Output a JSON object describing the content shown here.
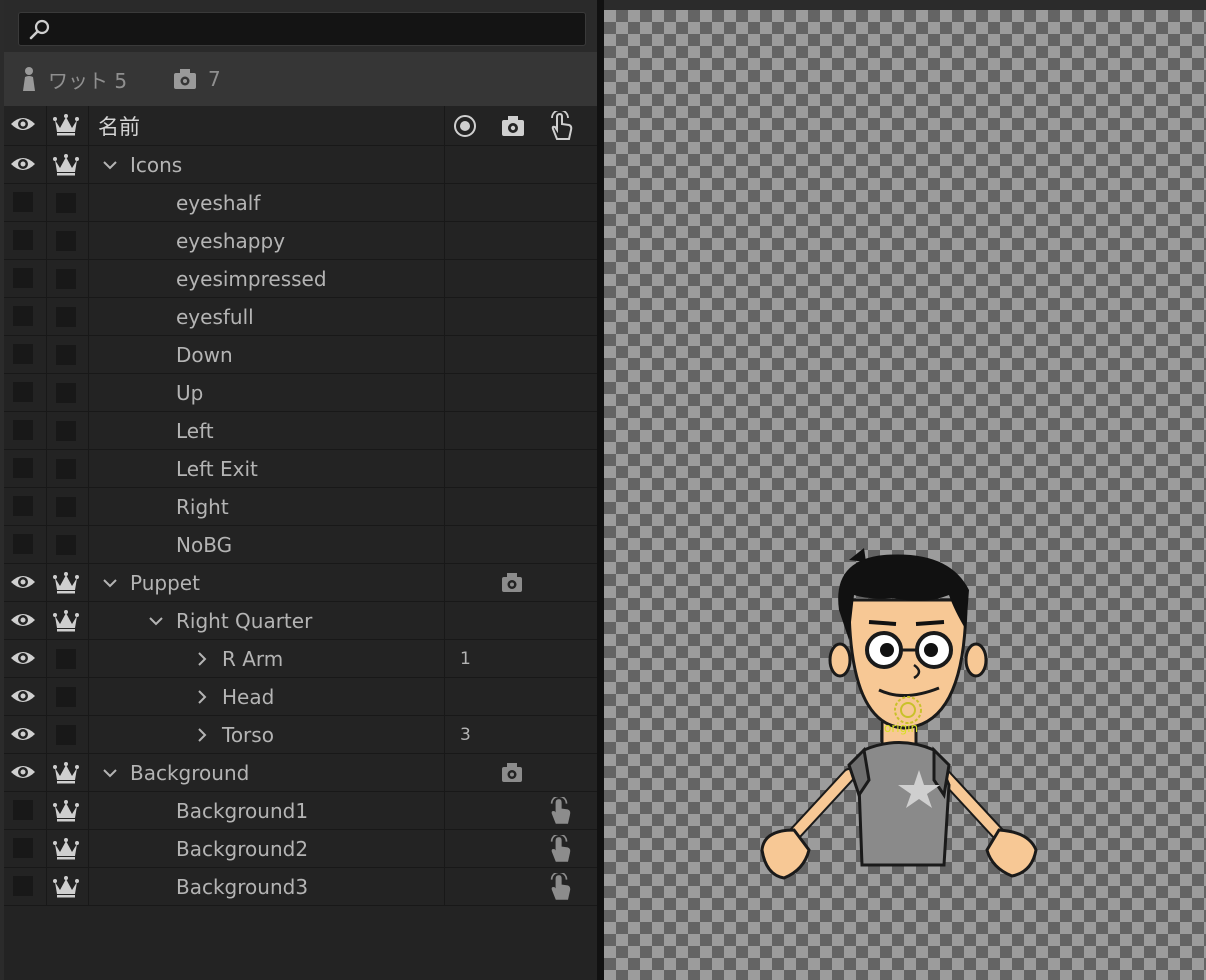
{
  "search": {
    "placeholder": "",
    "value": ""
  },
  "stats": {
    "puppets_label": "ワット 5",
    "cameras_label": "7"
  },
  "header": {
    "name_label": "名前"
  },
  "rows": [
    {
      "name": "Icons",
      "eye": true,
      "crown": true,
      "expand": "open",
      "indent": 0
    },
    {
      "name": "eyeshalf",
      "eye": false,
      "crown": false,
      "expand": "none",
      "indent": 1
    },
    {
      "name": "eyeshappy",
      "eye": false,
      "crown": false,
      "expand": "none",
      "indent": 1
    },
    {
      "name": "eyesimpressed",
      "eye": false,
      "crown": false,
      "expand": "none",
      "indent": 1
    },
    {
      "name": "eyesfull",
      "eye": false,
      "crown": false,
      "expand": "none",
      "indent": 1
    },
    {
      "name": "Down",
      "eye": false,
      "crown": false,
      "expand": "none",
      "indent": 1
    },
    {
      "name": "Up",
      "eye": false,
      "crown": false,
      "expand": "none",
      "indent": 1
    },
    {
      "name": "Left",
      "eye": false,
      "crown": false,
      "expand": "none",
      "indent": 1
    },
    {
      "name": "Left Exit",
      "eye": false,
      "crown": false,
      "expand": "none",
      "indent": 1
    },
    {
      "name": "Right",
      "eye": false,
      "crown": false,
      "expand": "none",
      "indent": 1
    },
    {
      "name": "NoBG",
      "eye": false,
      "crown": false,
      "expand": "none",
      "indent": 1
    },
    {
      "name": "Puppet",
      "eye": true,
      "crown": true,
      "expand": "open",
      "indent": 0,
      "camera": true
    },
    {
      "name": "Right Quarter",
      "eye": true,
      "crown": true,
      "expand": "open",
      "indent": 1
    },
    {
      "name": "R Arm",
      "eye": true,
      "crown": false,
      "expand": "closed",
      "indent": 2,
      "number": "1"
    },
    {
      "name": "Head",
      "eye": true,
      "crown": false,
      "expand": "closed",
      "indent": 2
    },
    {
      "name": "Torso",
      "eye": true,
      "crown": false,
      "expand": "closed",
      "indent": 2,
      "number": "3"
    },
    {
      "name": "Background",
      "eye": true,
      "crown": true,
      "expand": "open",
      "indent": 0,
      "camera": true
    },
    {
      "name": "Background1",
      "eye": false,
      "crown": true,
      "expand": "none",
      "indent": 1,
      "hand": true
    },
    {
      "name": "Background2",
      "eye": false,
      "crown": true,
      "expand": "none",
      "indent": 1,
      "hand": true
    },
    {
      "name": "Background3",
      "eye": false,
      "crown": true,
      "expand": "none",
      "indent": 1,
      "hand": true
    }
  ],
  "stage": {
    "origin_label": "origin"
  },
  "colors": {
    "panel_bg": "#232323",
    "stage_checker_light": "#9c9c9c",
    "stage_checker_dark": "#646464",
    "origin_marker": "#d7e023"
  }
}
